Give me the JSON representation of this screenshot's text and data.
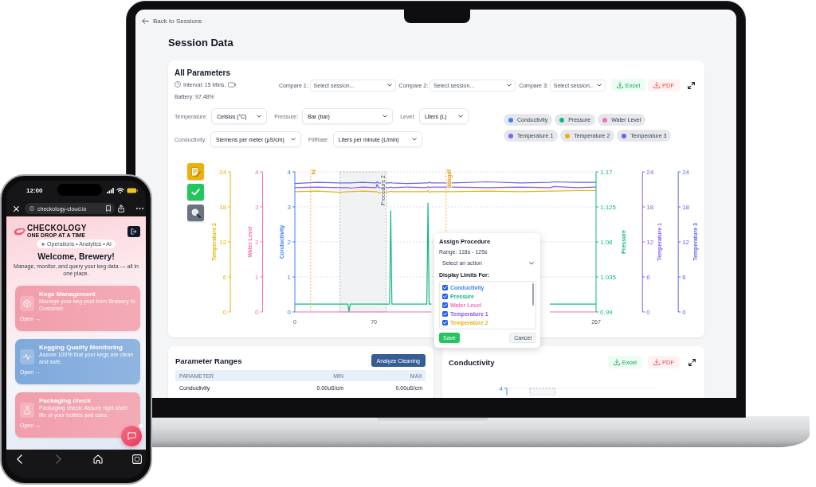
{
  "laptop": {
    "back_link": "Back to Sessions",
    "page_title": "Session Data",
    "all_parameters": {
      "title": "All Parameters",
      "interval": "Interval: 15 Mins.",
      "battery": "Battery: 97.48%",
      "compare": [
        {
          "label": "Compare 1:",
          "placeholder": "Select session..."
        },
        {
          "label": "Compare 2:",
          "placeholder": "Select session..."
        },
        {
          "label": "Compare 3:",
          "placeholder": "Select session..."
        }
      ],
      "export_buttons": [
        {
          "kind": "excel",
          "label": "Excel"
        },
        {
          "kind": "pdf",
          "label": "PDF"
        }
      ],
      "units": [
        {
          "label": "Temperature:",
          "value": "Celsius (°C)"
        },
        {
          "label": "Pressure:",
          "value": "Bar (bar)"
        },
        {
          "label": "Level:",
          "value": "Liters (L)"
        },
        {
          "label": "Conductivity:",
          "value": "Siemens per meter (μS/cm)"
        },
        {
          "label": "FillRate:",
          "value": "Liters per minute (L/min)"
        }
      ],
      "tools": [
        {
          "kind": "note"
        },
        {
          "kind": "check"
        },
        {
          "kind": "zoom"
        }
      ],
      "chart_axes": [
        {
          "title": "Temperature 2",
          "ticks": [
            "24",
            "18",
            "12",
            "6",
            "0"
          ]
        },
        {
          "title": "Water Level",
          "ticks": [
            "4",
            "3",
            "2",
            "1",
            "0"
          ]
        },
        {
          "title": "Temperature 3",
          "ticks": [
            "24",
            "18",
            "12",
            "6",
            "0"
          ]
        }
      ],
      "chart_data": {
        "type": "line",
        "legend": "top right",
        "grid": true,
        "x": [
          0,
          20,
          40,
          47,
          48,
          49,
          60,
          72,
          73,
          74,
          84,
          85,
          86,
          100,
          117,
          118,
          119,
          121,
          140,
          170,
          200,
          226,
          230,
          250,
          267
        ],
        "xlim": [
          0,
          267
        ],
        "xticks": [
          0,
          70,
          267
        ],
        "ylabel": "Conductivity",
        "ylim": [
          0,
          4
        ],
        "yticks": [
          0,
          1,
          2,
          3,
          4
        ],
        "y2label": "Pressure",
        "y2lim": [
          0.99,
          1.17
        ],
        "y2ticks": [
          0.99,
          1.035,
          1.08,
          1.125,
          1.17
        ],
        "y3label": "Temperature 1",
        "y3lim": [
          0,
          24
        ],
        "y3ticks": [
          0,
          6,
          12,
          18,
          24
        ],
        "series": [
          {
            "name": "Conductivity",
            "color": "#3b82f6",
            "values": [
              null,
              null,
              null,
              null,
              null,
              null,
              null,
              null,
              null,
              null,
              null,
              null,
              null,
              null,
              null,
              null,
              null,
              null,
              null,
              null,
              null,
              null,
              null,
              null,
              null
            ]
          },
          {
            "name": "Pressure",
            "color": "#10b981",
            "axis": "y2",
            "values": [
              1.0,
              1.0,
              1.0,
              1.0,
              0.99,
              1.0,
              1.0,
              1.0,
              1.0,
              1.0,
              1.0,
              1.12,
              1.0,
              1.0,
              1.0,
              1.13,
              1.0,
              1.0,
              null,
              null,
              null,
              1.0,
              1.0,
              1.0,
              1.0
            ]
          },
          {
            "name": "Water Level",
            "color": "#f472b6",
            "values": [
              0,
              0,
              0,
              0,
              0,
              0,
              0,
              0,
              0,
              0,
              0,
              0,
              0,
              0,
              0,
              0,
              0,
              0,
              null,
              null,
              null,
              0,
              0,
              0,
              0
            ]
          },
          {
            "name": "Temperature 1",
            "color": "#8b5cf6",
            "axis": "y3",
            "values": [
              21.3,
              21.4,
              21.3,
              21.3,
              21.3,
              21.2,
              21.4,
              21.3,
              21.9,
              21.3,
              21.3,
              21.4,
              21.3,
              21.4,
              21.3,
              21.5,
              21.3,
              21.4,
              21.4,
              21.3,
              21.4,
              21.3,
              21.5,
              21.3,
              21.4
            ]
          },
          {
            "name": "Temperature 2",
            "color": "#eab308",
            "axis": "y3",
            "values": [
              20.6,
              20.7,
              20.5,
              20.6,
              20.6,
              20.6,
              20.7,
              20.6,
              20.6,
              20.4,
              20.6,
              20.7,
              20.6,
              20.6,
              20.6,
              20.8,
              20.5,
              20.6,
              20.6,
              20.7,
              20.6,
              20.7,
              20.7,
              20.8,
              20.8
            ]
          },
          {
            "name": "Temperature 3",
            "color": "#6366f1",
            "axis": "y3",
            "values": [
              22.0,
              22.2,
              22.1,
              22.1,
              22.1,
              22.1,
              22.2,
              22.1,
              22.3,
              22.1,
              22.1,
              22.2,
              22.1,
              22.0,
              22.1,
              22.1,
              22.2,
              22.1,
              22.1,
              22.3,
              22.1,
              22.2,
              22.3,
              22.2,
              22.2
            ]
          }
        ],
        "ref_lines": [
          {
            "axis": "x",
            "value": 14,
            "label": "hi"
          },
          {
            "axis": "x",
            "value": 134,
            "label": "ddsgdf"
          }
        ],
        "bands": [
          {
            "axis": "x",
            "from": 40,
            "to": 81,
            "label": "Procedure 2"
          }
        ]
      },
      "procedure_popup": {
        "title": "Assign Procedure",
        "range": "Range: 118s - 125s",
        "action_select": {
          "placeholder": "Select an action"
        },
        "limits_title": "Display Limits For:",
        "limits": [
          {
            "label": "Conductivity",
            "checked": true,
            "color": "#3b82f6"
          },
          {
            "label": "Pressure",
            "checked": true,
            "color": "#10b981"
          },
          {
            "label": "Water Level",
            "checked": true,
            "color": "#f472b6"
          },
          {
            "label": "Temperature 1",
            "checked": true,
            "color": "#8b5cf6"
          },
          {
            "label": "Temperature 2",
            "checked": true,
            "color": "#eab308"
          }
        ],
        "buttons": [
          {
            "kind": "save",
            "label": "Save"
          },
          {
            "kind": "cancel",
            "label": "Cancel"
          }
        ]
      }
    },
    "parameter_ranges": {
      "title": "Parameter Ranges",
      "action": "Analyze Cleaning",
      "columns": [
        "PARAMETER",
        "MIN",
        "MAX"
      ],
      "rows": [
        [
          "Conductivity",
          "0.00uS/cm",
          "0.00uS/cm"
        ]
      ]
    },
    "conductivity_panel": {
      "title": "Conductivity",
      "export_buttons": [
        {
          "kind": "excel",
          "label": "Excel"
        },
        {
          "kind": "pdf",
          "label": "PDF"
        }
      ],
      "chart_ticks": [
        "4"
      ]
    }
  },
  "phone": {
    "time": "12:00",
    "url": "checkology-cloud.io",
    "brand": "CHECKOLOGY",
    "tagline": "ONE DROP AT A TIME",
    "chip": "Operations • Analytics • AI",
    "welcome": "Welcome, Brewery!",
    "intro": "Manage, monitor, and query your keg data — all in one place.",
    "cards": [
      {
        "kind": "kegs",
        "title": "Kegs Management",
        "text": "Manage your keg pool from Brewery to Customer.",
        "link": "Open →",
        "color": "#f29dab"
      },
      {
        "kind": "monitoring",
        "title": "Kegging Quality Monitoring",
        "text": "Assure 100% that your kegs are clean and safe.",
        "link": "Open →",
        "color": "#7ea9dc"
      },
      {
        "kind": "packaging",
        "title": "Packaging check",
        "text": "Packaging check: Assure right shelf life of your bottles and cans.",
        "link": "Open →",
        "color": "#f29dab"
      }
    ],
    "chat": {
      "unread": true
    },
    "nav": [
      {
        "kind": "back",
        "disabled": false
      },
      {
        "kind": "forward",
        "disabled": true
      },
      {
        "kind": "home",
        "disabled": false
      },
      {
        "kind": "tabs",
        "disabled": false
      }
    ]
  }
}
